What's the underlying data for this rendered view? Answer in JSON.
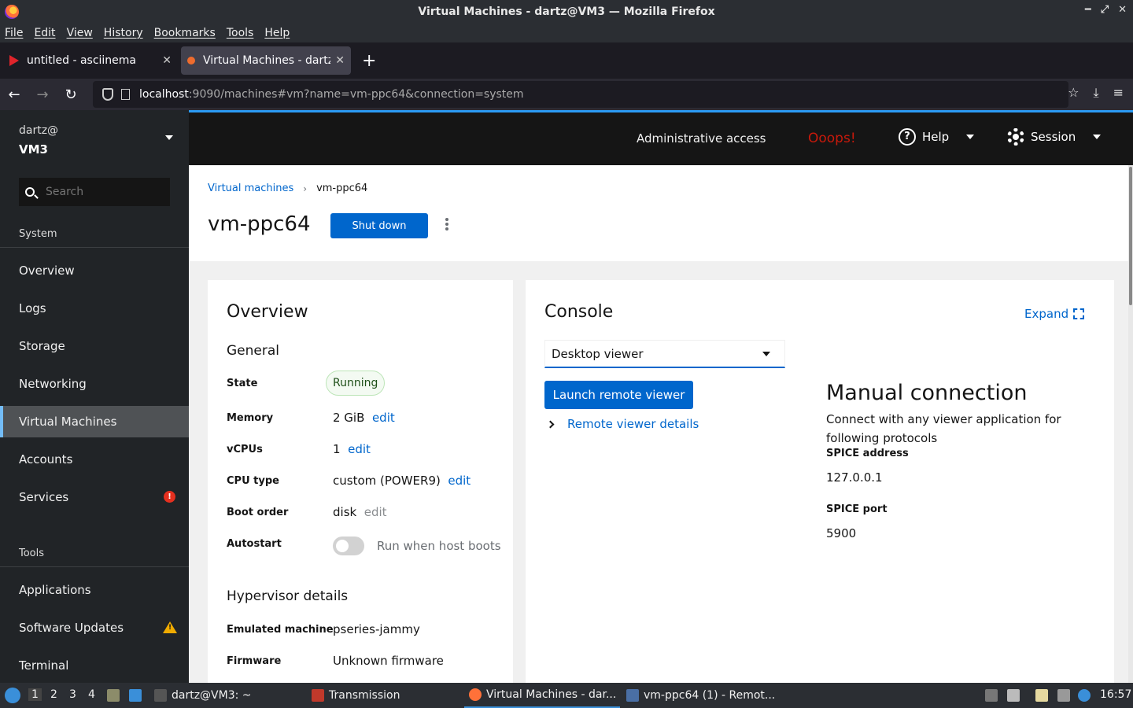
{
  "window": {
    "title": "Virtual Machines - dartz@VM3 — Mozilla Firefox"
  },
  "menubar": [
    "File",
    "Edit",
    "View",
    "History",
    "Bookmarks",
    "Tools",
    "Help"
  ],
  "tabs": [
    {
      "label": "untitled - asciinema",
      "active": false
    },
    {
      "label": "Virtual Machines - dartz@",
      "active": true
    }
  ],
  "url": {
    "host": "localhost",
    "rest": ":9090/machines#vm?name=vm-ppc64&connection=system"
  },
  "sidebar": {
    "user": "dartz@",
    "host": "VM3",
    "search_placeholder": "Search",
    "system_label": "System",
    "tools_label": "Tools",
    "items": [
      {
        "label": "Overview"
      },
      {
        "label": "Logs"
      },
      {
        "label": "Storage"
      },
      {
        "label": "Networking"
      },
      {
        "label": "Virtual Machines",
        "active": true
      },
      {
        "label": "Accounts"
      },
      {
        "label": "Services",
        "badge": "!"
      },
      {
        "label": "Applications"
      },
      {
        "label": "Software Updates",
        "badge": "!"
      },
      {
        "label": "Terminal"
      }
    ]
  },
  "masthead": {
    "admin": "Administrative access",
    "oops": "Ooops!",
    "help": "Help",
    "help_icon": "?",
    "session": "Session"
  },
  "page": {
    "breadcrumb_root": "Virtual machines",
    "breadcrumb_current": "vm-ppc64",
    "title": "vm-ppc64",
    "shutdown": "Shut down"
  },
  "overview": {
    "title": "Overview",
    "general_title": "General",
    "state_label": "State",
    "state_value": "Running",
    "memory_label": "Memory",
    "memory_value": "2 GiB",
    "vcpus_label": "vCPUs",
    "vcpus_value": "1",
    "cputype_label": "CPU type",
    "cputype_value": "custom (POWER9)",
    "boot_label": "Boot order",
    "boot_value": "disk",
    "edit": "edit",
    "autostart_label": "Autostart",
    "autostart_text": "Run when host boots",
    "hypervisor_title": "Hypervisor details",
    "emulated_label": "Emulated machine",
    "emulated_value": "pseries-jammy",
    "firmware_label": "Firmware",
    "firmware_value": "Unknown firmware"
  },
  "console": {
    "title": "Console",
    "expand": "Expand",
    "viewer_select": "Desktop viewer",
    "launch": "Launch remote viewer",
    "details": "Remote viewer details",
    "manual_title": "Manual connection",
    "manual_desc": "Connect with any viewer application for following protocols",
    "spice_address_label": "SPICE address",
    "spice_address_value": "127.0.0.1",
    "spice_port_label": "SPICE port",
    "spice_port_value": "5900"
  },
  "taskbar": {
    "workspaces": [
      "1",
      "2",
      "3",
      "4"
    ],
    "tasks": [
      {
        "label": "dartz@VM3: ~"
      },
      {
        "label": "Transmission"
      },
      {
        "label": "Virtual Machines - dar..."
      },
      {
        "label": "vm-ppc64 (1) - Remot..."
      }
    ],
    "clock": "16:57"
  },
  "colors": {
    "accent": "#0066cc",
    "masthead": "#151515",
    "sidebar": "#212427",
    "error": "#c9190b"
  }
}
